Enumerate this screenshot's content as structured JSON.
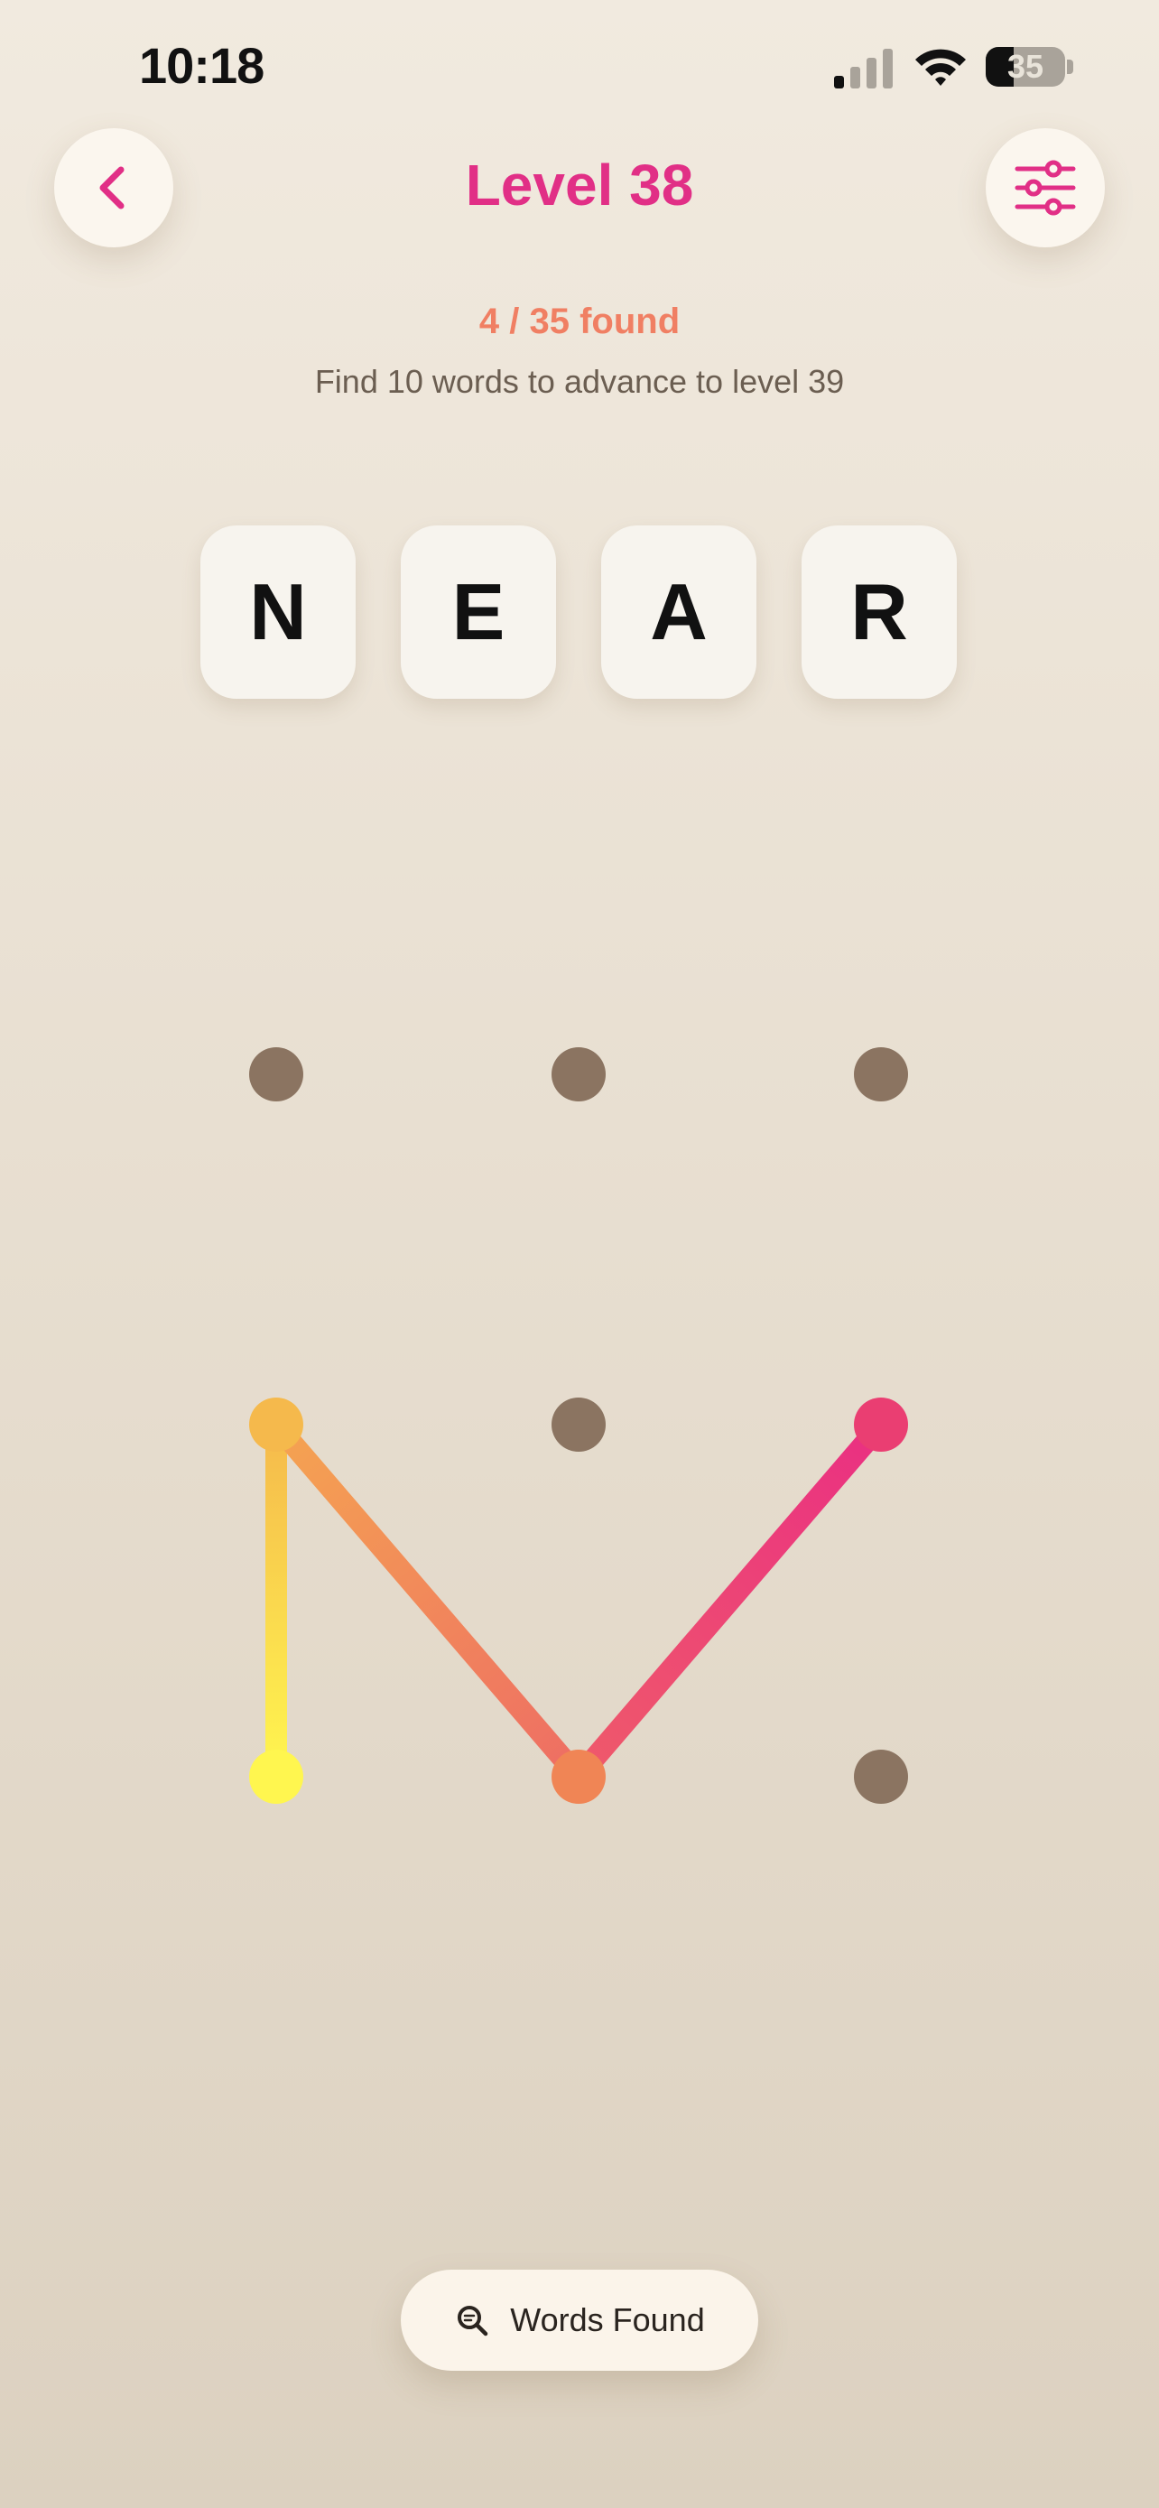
{
  "status_bar": {
    "time": "10:18",
    "battery_percent": "35",
    "icons": [
      "signal-icon",
      "wifi-icon",
      "battery-icon"
    ]
  },
  "header": {
    "back_icon": "chevron-left-icon",
    "title": "Level 38",
    "settings_icon": "sliders-icon"
  },
  "progress": {
    "found_text": "4 / 35 found",
    "advance_text": "Find 10 words to advance to level 39"
  },
  "current_word": {
    "letters": [
      "N",
      "E",
      "A",
      "R"
    ]
  },
  "dot_grid": {
    "rows": 3,
    "cols": 3,
    "active_path": [
      [
        2,
        0
      ],
      [
        1,
        0
      ],
      [
        2,
        1
      ],
      [
        1,
        2
      ]
    ]
  },
  "words_found_button": {
    "label": "Words Found",
    "icon": "search-icon"
  },
  "colors": {
    "accent": "#e12f86",
    "count": "#f07f63",
    "dot_inactive": "#8b7461",
    "path_start": "#fff64f",
    "path_mid": "#f08555",
    "path_end": "#ea2f82"
  }
}
